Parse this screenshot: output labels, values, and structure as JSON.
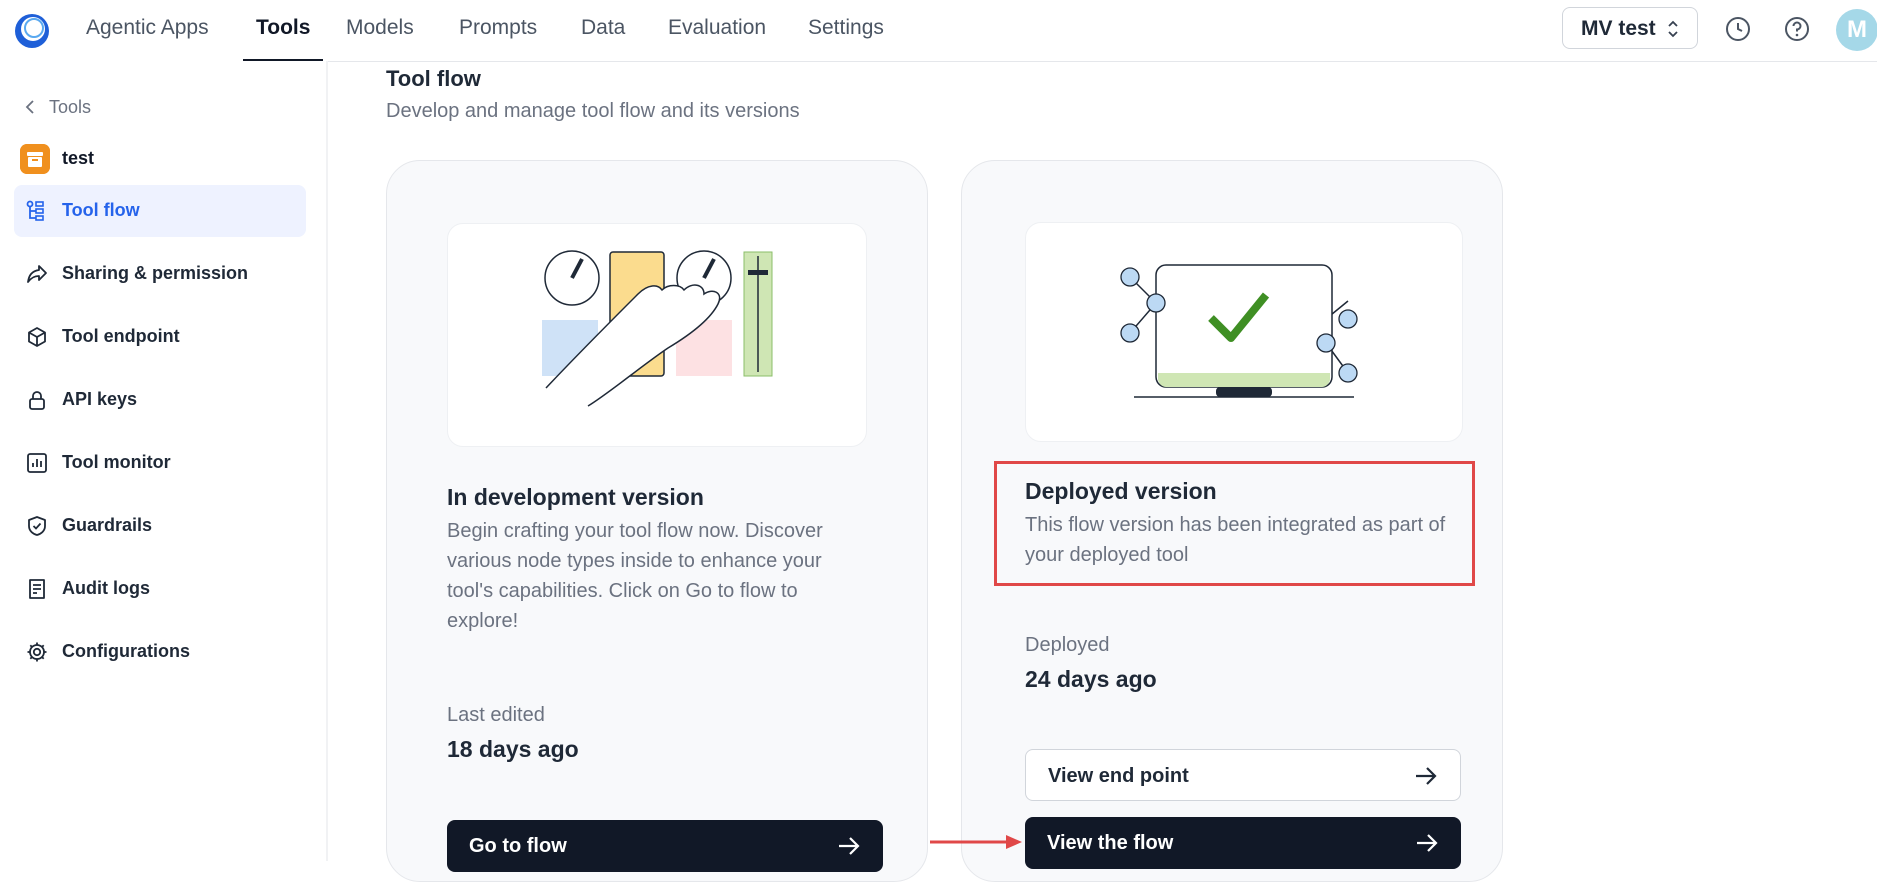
{
  "nav": {
    "items": [
      {
        "label": "Agentic Apps",
        "active": false
      },
      {
        "label": "Tools",
        "active": true
      },
      {
        "label": "Models",
        "active": false
      },
      {
        "label": "Prompts",
        "active": false
      },
      {
        "label": "Data",
        "active": false
      },
      {
        "label": "Evaluation",
        "active": false
      },
      {
        "label": "Settings",
        "active": false
      }
    ],
    "environment": "MV test",
    "avatar_initial": "M"
  },
  "sidebar": {
    "back_label": "Tools",
    "tool_name": "test",
    "items": [
      {
        "label": "Tool flow",
        "icon": "flow-icon",
        "active": true
      },
      {
        "label": "Sharing & permission",
        "icon": "share-icon",
        "active": false
      },
      {
        "label": "Tool endpoint",
        "icon": "cube-icon",
        "active": false
      },
      {
        "label": "API keys",
        "icon": "lock-icon",
        "active": false
      },
      {
        "label": "Tool monitor",
        "icon": "chart-icon",
        "active": false
      },
      {
        "label": "Guardrails",
        "icon": "shield-icon",
        "active": false
      },
      {
        "label": "Audit logs",
        "icon": "document-icon",
        "active": false
      },
      {
        "label": "Configurations",
        "icon": "gear-icon",
        "active": false
      }
    ]
  },
  "main": {
    "title": "Tool flow",
    "subtitle": "Develop and manage tool flow and its versions",
    "dev_card": {
      "title": "In development version",
      "description": "Begin crafting your tool flow now. Discover various node types inside to enhance your tool's capabilities. Click on Go to flow to explore!",
      "meta_label": "Last edited",
      "meta_value": "18 days ago",
      "button": "Go to flow"
    },
    "deployed_card": {
      "title": "Deployed version",
      "description": "This flow version has been integrated as part of your deployed tool",
      "meta_label": "Deployed",
      "meta_value": "24 days ago",
      "button_secondary": "View end point",
      "button_primary": "View the flow"
    }
  },
  "colors": {
    "accent": "#2563eb",
    "annotation": "#e04848",
    "primary_button": "#111827"
  }
}
